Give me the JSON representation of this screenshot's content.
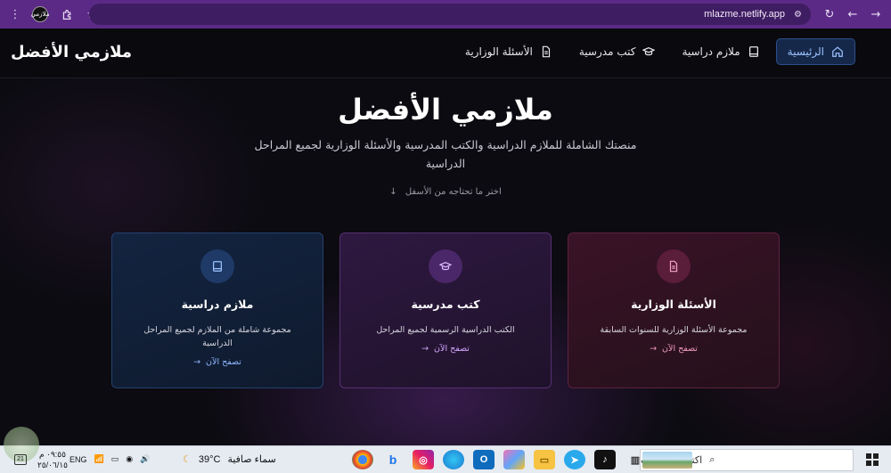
{
  "browser": {
    "url": "mlazme.netlify.app",
    "favicon_text": "ملازمي"
  },
  "header": {
    "logo": "ملازمي الأفضل",
    "nav": [
      {
        "label": "الرئيسية",
        "icon": "home-icon",
        "active": true
      },
      {
        "label": "ملازم دراسية",
        "icon": "book-icon",
        "active": false
      },
      {
        "label": "كتب مدرسية",
        "icon": "graduation-cap-icon",
        "active": false
      },
      {
        "label": "الأسئلة الوزارية",
        "icon": "document-icon",
        "active": false
      }
    ]
  },
  "hero": {
    "title": "ملازمي الأفضل",
    "subtitle": "منصتك الشاملة للملازم الدراسية والكتب المدرسية والأسئلة الوزارية لجميع المراحل الدراسية",
    "hint": "اختر ما تحتاجه من الأسفل"
  },
  "cards": [
    {
      "title": "الأسئلة الوزارية",
      "desc": "مجموعة الأسئلة الوزارية للسنوات السابقة",
      "link": "تصفح الآن",
      "icon": "document-icon",
      "accent": "#f29bbf"
    },
    {
      "title": "كتب مدرسية",
      "desc": "الكتب الدراسية الرسمية لجميع المراحل",
      "link": "تصفح الآن",
      "icon": "graduation-cap-icon",
      "accent": "#d3a8ff"
    },
    {
      "title": "ملازم دراسية",
      "desc": "مجموعة شاملة من الملازم لجميع المراحل الدراسية",
      "link": "تصفح الآن",
      "icon": "book-icon",
      "accent": "#8fb8ff"
    }
  ],
  "taskbar": {
    "search_placeholder": "اكتب هنا للبحث",
    "weather_temp": "39°C",
    "weather_text": "سماء صافية",
    "language": "ENG",
    "time": "٠٩:٥٥ م",
    "date": "٢٥/٠٦/١٥",
    "notification_count": "21"
  }
}
